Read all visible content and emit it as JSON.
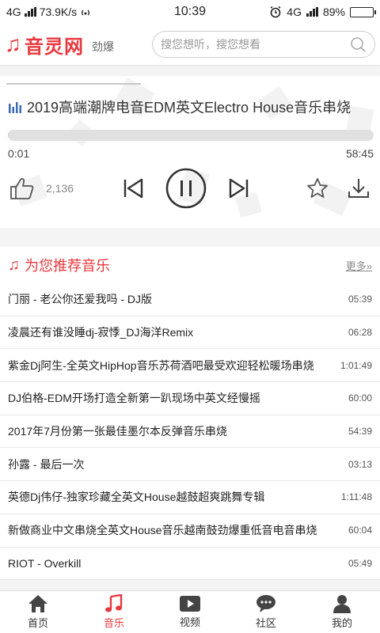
{
  "status_bar": {
    "network": "4G",
    "speed": "73.9K/s",
    "time": "10:39",
    "network_right": "4G",
    "battery": "89%",
    "battery_level": 0.89
  },
  "app_bar": {
    "brand": "音灵网",
    "subtitle": "劲爆",
    "search_placeholder": "搜您想听，搜您想看"
  },
  "player": {
    "title": "2019高端潮牌电音EDM英文Electro House音乐串烧",
    "current_time": "0:01",
    "total_time": "58:45",
    "progress": 0.0003,
    "like_count": "2,136"
  },
  "recommend": {
    "title": "为您推荐音乐",
    "more": "更多»"
  },
  "songs": [
    {
      "name": "门丽 - 老公你还爱我吗 - DJ版",
      "duration": "05:39"
    },
    {
      "name": "凌晨还有谁没睡dj-寂悸_DJ海洋Remix",
      "duration": "06:28"
    },
    {
      "name": "紫金Dj阿生-全英文HipHop音乐苏荷酒吧最受欢迎轻松暖场串烧",
      "duration": "1:01:49"
    },
    {
      "name": "DJ伯格-EDM开场打造全新第一趴现场中英文经慢摇",
      "duration": "60:00"
    },
    {
      "name": "2017年7月份第一张最佳墨尔本反弹音乐串烧",
      "duration": "54:39"
    },
    {
      "name": "孙露 - 最后一次",
      "duration": "03:13"
    },
    {
      "name": "英德Dj伟仔-独家珍藏全英文House越鼓超爽跳舞专辑",
      "duration": "1:11:48"
    },
    {
      "name": "新做商业中文串烧全英文House音乐越南鼓劲爆重低音电音串烧",
      "duration": "60:04"
    },
    {
      "name": "RIOT - Overkill",
      "duration": "05:49"
    }
  ],
  "tabs": [
    {
      "label": "首页",
      "icon": "home-icon"
    },
    {
      "label": "音乐",
      "icon": "music-note-icon",
      "active": true
    },
    {
      "label": "视频",
      "icon": "video-icon"
    },
    {
      "label": "社区",
      "icon": "chat-icon"
    },
    {
      "label": "我的",
      "icon": "user-icon"
    }
  ],
  "colors": {
    "accent": "#e8383d"
  }
}
